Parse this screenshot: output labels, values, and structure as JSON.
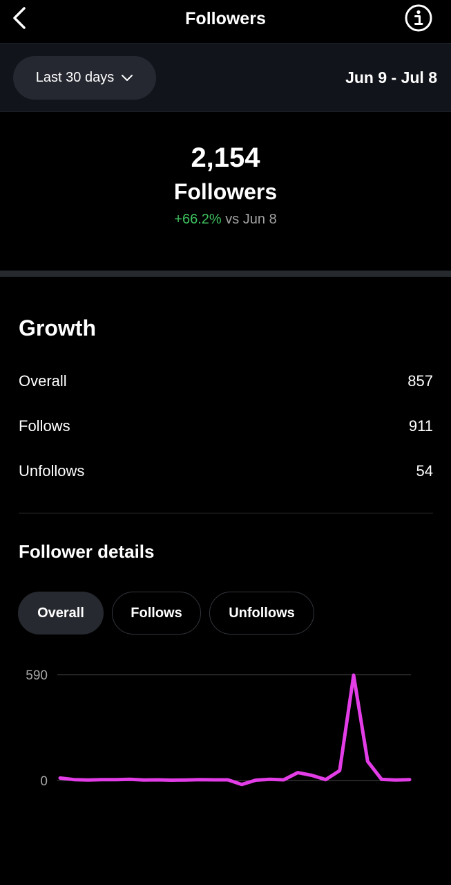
{
  "header": {
    "title": "Followers",
    "back_icon": "chevron-left-icon",
    "info_icon": "info-icon"
  },
  "filter": {
    "range_label": "Last 30 days",
    "range_icon": "chevron-down-icon",
    "date_range": "Jun 9 - Jul 8"
  },
  "summary": {
    "count": "2,154",
    "label": "Followers",
    "change_percent": "+66.2%",
    "change_vs": "vs Jun 8",
    "change_color": "#3fc35f"
  },
  "growth": {
    "title": "Growth",
    "rows": [
      {
        "label": "Overall",
        "value": "857"
      },
      {
        "label": "Follows",
        "value": "911"
      },
      {
        "label": "Unfollows",
        "value": "54"
      }
    ]
  },
  "details": {
    "title": "Follower details",
    "tabs": [
      {
        "label": "Overall",
        "active": true
      },
      {
        "label": "Follows",
        "active": false
      },
      {
        "label": "Unfollows",
        "active": false
      }
    ]
  },
  "chart_data": {
    "type": "line",
    "title": "",
    "xlabel": "",
    "ylabel": "",
    "y_ticks": [
      "590",
      "0"
    ],
    "ylim": [
      0,
      590
    ],
    "x": [
      1,
      2,
      3,
      4,
      5,
      6,
      7,
      8,
      9,
      10,
      11,
      12,
      13,
      14,
      15,
      16,
      17,
      18,
      19,
      20,
      21,
      22,
      23,
      24,
      25,
      26
    ],
    "series": [
      {
        "color": "#e23de6",
        "values": [
          14,
          5,
          3,
          5,
          5,
          7,
          3,
          4,
          2,
          3,
          5,
          4,
          4,
          -22,
          2,
          7,
          4,
          44,
          29,
          5,
          55,
          587,
          107,
          6,
          3,
          5
        ]
      }
    ],
    "grid": true,
    "legend": "none"
  }
}
